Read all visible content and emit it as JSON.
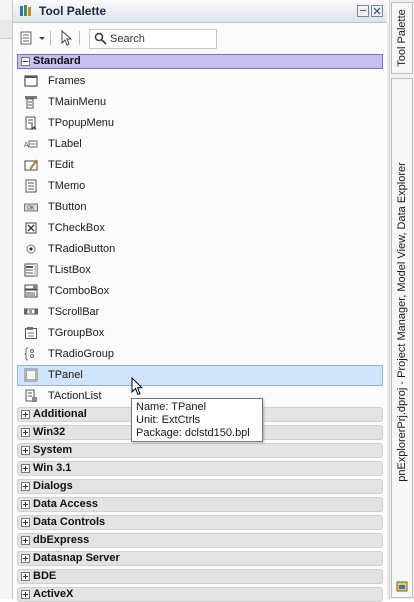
{
  "window": {
    "title": "Tool Palette"
  },
  "toolbar": {
    "search_placeholder": "Search"
  },
  "expanded_category": {
    "label": "Standard"
  },
  "components": [
    {
      "label": "Frames",
      "icon": "frames-icon"
    },
    {
      "label": "TMainMenu",
      "icon": "main-menu-icon"
    },
    {
      "label": "TPopupMenu",
      "icon": "popup-menu-icon"
    },
    {
      "label": "TLabel",
      "icon": "label-icon"
    },
    {
      "label": "TEdit",
      "icon": "edit-icon"
    },
    {
      "label": "TMemo",
      "icon": "memo-icon"
    },
    {
      "label": "TButton",
      "icon": "button-icon"
    },
    {
      "label": "TCheckBox",
      "icon": "checkbox-icon"
    },
    {
      "label": "TRadioButton",
      "icon": "radio-button-icon"
    },
    {
      "label": "TListBox",
      "icon": "listbox-icon"
    },
    {
      "label": "TComboBox",
      "icon": "combobox-icon"
    },
    {
      "label": "TScrollBar",
      "icon": "scrollbar-icon"
    },
    {
      "label": "TGroupBox",
      "icon": "groupbox-icon"
    },
    {
      "label": "TRadioGroup",
      "icon": "radio-group-icon"
    },
    {
      "label": "TPanel",
      "icon": "panel-icon",
      "selected": true
    },
    {
      "label": "TActionList",
      "icon": "action-list-icon"
    }
  ],
  "tooltip": {
    "name": "Name: TPanel",
    "unit": "Unit: ExtCtrls",
    "package": "Package: dclstd150.bpl"
  },
  "categories": [
    "Additional",
    "Win32",
    "System",
    "Win 3.1",
    "Dialogs",
    "Data Access",
    "Data Controls",
    "dbExpress",
    "Datasnap Server",
    "BDE",
    "ActiveX"
  ],
  "right_tabs": {
    "tool_palette": "Tool Palette",
    "project": "pnExplorerPrj.dproj - Project Manager, Model View, Data Explorer"
  },
  "colors": {
    "selected_category": "#c6bff2",
    "selected_item": "#cfe3fb",
    "title_accent": "#1d2a3d"
  }
}
